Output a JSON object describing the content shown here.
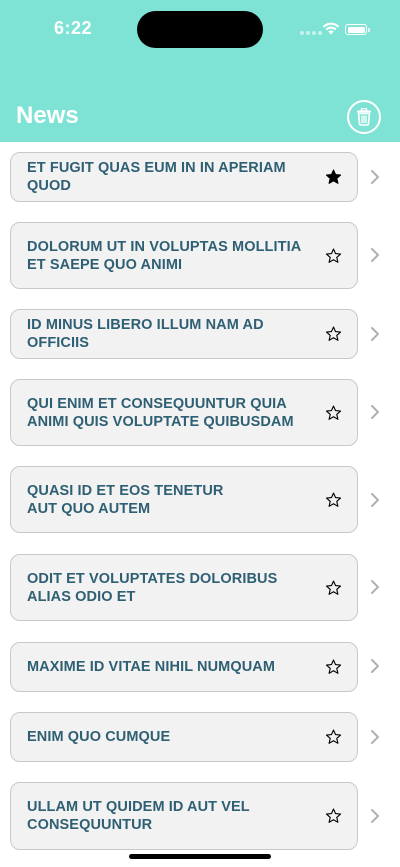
{
  "status_bar": {
    "time": "6:22"
  },
  "header": {
    "title": "News",
    "trash_icon": "trash-icon"
  },
  "colors": {
    "header_bg": "#7ee3d5",
    "card_bg": "#f2f2f2",
    "title_text": "#2e5f73"
  },
  "news": [
    {
      "title": "ET FUGIT QUAS EUM IN IN APERIAM QUOD",
      "favorite": true
    },
    {
      "title": "DOLORUM UT IN VOLUPTAS MOLLITIA ET SAEPE QUO ANIMI",
      "favorite": false
    },
    {
      "title": "ID MINUS LIBERO ILLUM NAM AD OFFICIIS",
      "favorite": false
    },
    {
      "title": "QUI ENIM ET CONSEQUUNTUR QUIA ANIMI QUIS VOLUPTATE QUIBUSDAM",
      "favorite": false
    },
    {
      "title": "QUASI ID ET EOS TENETUR AUT QUO AUTEM",
      "favorite": false
    },
    {
      "title": "ODIT ET VOLUPTATES DOLORIBUS ALIAS ODIO ET",
      "favorite": false
    },
    {
      "title": "MAXIME ID VITAE NIHIL NUMQUAM",
      "favorite": false
    },
    {
      "title": "ENIM QUO CUMQUE",
      "favorite": false
    },
    {
      "title": "ULLAM UT QUIDEM ID AUT VEL CONSEQUUNTUR",
      "favorite": false
    }
  ]
}
